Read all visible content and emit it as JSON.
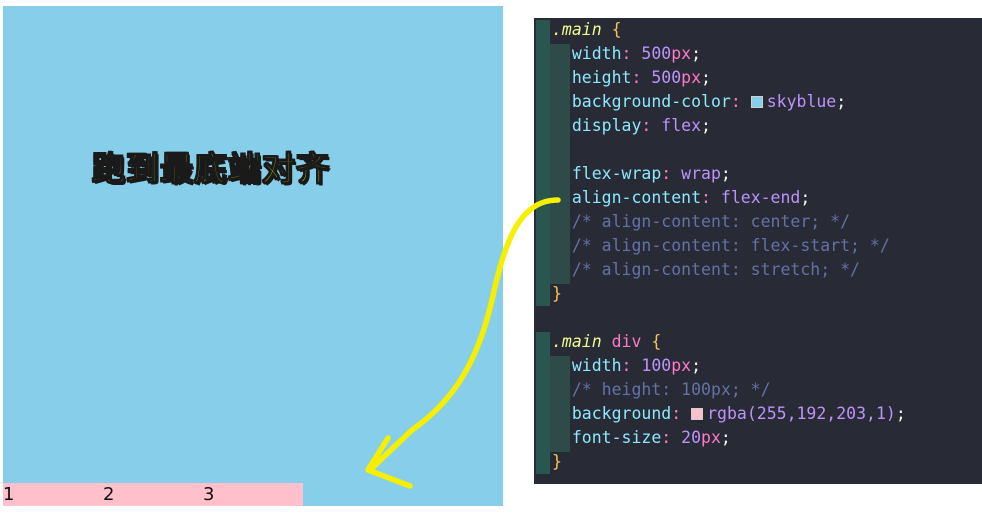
{
  "demo": {
    "title": "跑到最底端对齐",
    "items": [
      "1",
      "2",
      "3"
    ]
  },
  "code": {
    "main_selector": ".main",
    "open_brace": "{",
    "close_brace": "}",
    "main_div_selector_class": ".main",
    "main_div_selector_tag": "div",
    "lines": [
      {
        "prop": "width",
        "value": "500",
        "unit": "px"
      },
      {
        "prop": "height",
        "value": "500",
        "unit": "px"
      },
      {
        "prop": "background-color",
        "value": "skyblue"
      },
      {
        "prop": "display",
        "value": "flex"
      },
      {
        "prop": "flex-wrap",
        "value": "wrap"
      },
      {
        "prop": "align-content",
        "value": "flex-end"
      }
    ],
    "comments": [
      "/* align-content: center; */",
      "/* align-content: flex-start; */",
      "/* align-content: stretch; */"
    ],
    "div_lines": [
      {
        "prop": "width",
        "value": "100",
        "unit": "px"
      },
      {
        "comment": "/* height: 100px; */"
      },
      {
        "prop": "background",
        "value": "rgba(255,192,203,1)"
      },
      {
        "prop": "font-size",
        "value": "20",
        "unit": "px"
      }
    ]
  },
  "colors": {
    "demo_background": "#87ceeb",
    "item_background": "#ffc0cb",
    "panel_background": "#282a36",
    "arrow": "#f6f000"
  }
}
